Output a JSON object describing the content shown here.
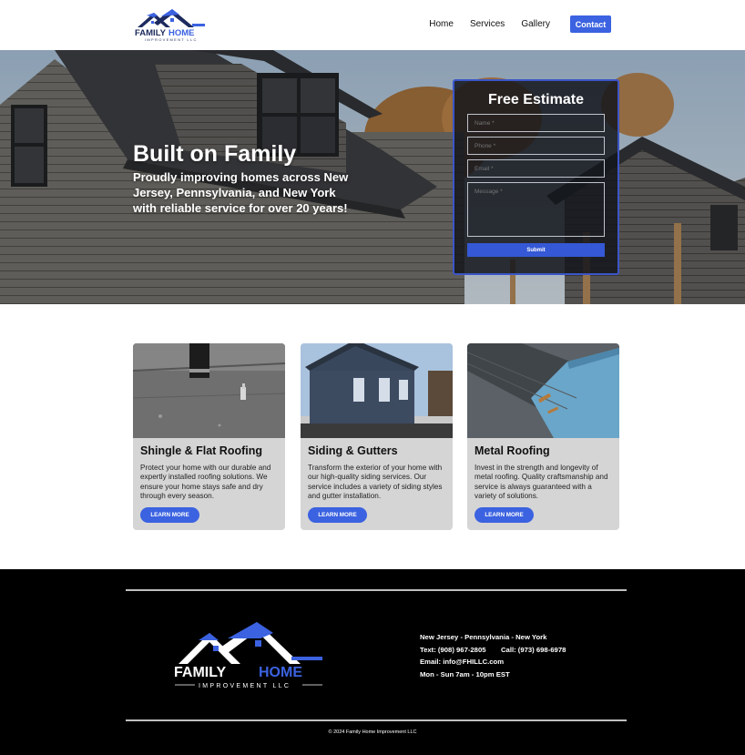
{
  "brand": {
    "name_line1": "FAMILY HOME",
    "name_line2": "IMPROVEMENT LLC",
    "colors": {
      "accent": "#3b62e0",
      "navy": "#1d2a5e",
      "card_bg": "#d5d5d5",
      "footer_bg": "#000000"
    }
  },
  "nav": {
    "items": [
      {
        "label": "Home"
      },
      {
        "label": "Services"
      },
      {
        "label": "Gallery"
      }
    ],
    "contact_label": "Contact"
  },
  "hero": {
    "title": "Built on Family",
    "subtitle": "Proudly improving homes across New Jersey, Pennsylvania, and New York with reliable service for over 20 years!"
  },
  "estimate_form": {
    "title": "Free Estimate",
    "name_placeholder": "Name *",
    "phone_placeholder": "Phone *",
    "email_placeholder": "Email *",
    "message_placeholder": "Message *",
    "submit_label": "Submit"
  },
  "services": [
    {
      "title": "Shingle & Flat Roofing",
      "description": "Protect your home with our durable and expertly installed roofing solutions. We ensure your home stays safe and dry through every season.",
      "button": "LEARN MORE",
      "image_icon": "roof-shingle-photo"
    },
    {
      "title": "Siding & Gutters",
      "description": "Transform the exterior of your home with our high-quality siding services. Our service includes a variety of siding styles and gutter installation.",
      "button": "LEARN MORE",
      "image_icon": "house-siding-photo"
    },
    {
      "title": "Metal Roofing",
      "description": "Invest in the strength and longevity of metal roofing. Quality craftsmanship and service is always guaranteed with a variety of solutions.",
      "button": "LEARN MORE",
      "image_icon": "metal-roof-photo"
    }
  ],
  "footer": {
    "regions": "New Jersey - Pennsylvania - New York",
    "text_line": "Text: (908) 967-2805",
    "call_line": "Call: (973) 698-6978",
    "email_line": "Email: info@FHILLC.com",
    "hours_line": "Mon - Sun 7am - 10pm EST",
    "copyright": "© 2024 Family Home Improvement LLC"
  }
}
